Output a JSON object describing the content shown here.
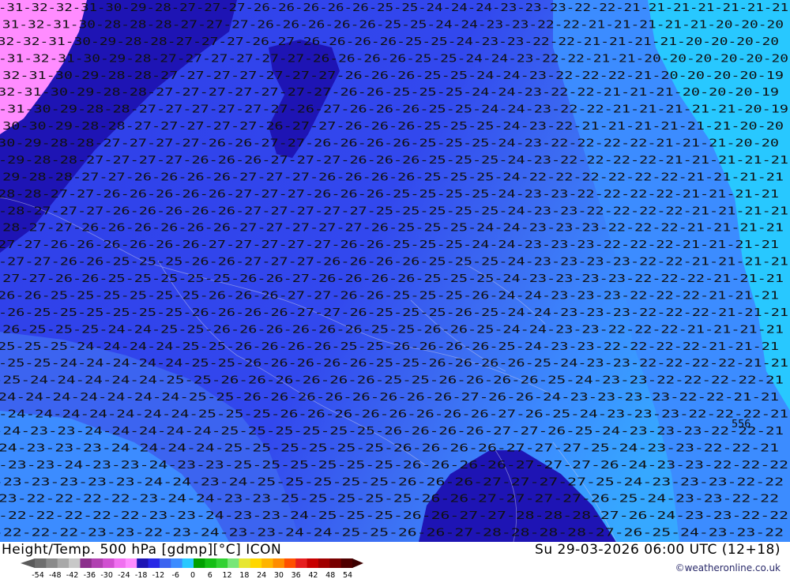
{
  "title": "Height/Temp. 500 hPa [gdmp][°C] ICON",
  "valid_time": "Su 29-03-2026 06:00 UTC (12+18)",
  "credit": "©weatheronline.co.uk",
  "scale": {
    "ticks": [
      "-54",
      "-48",
      "-42",
      "-36",
      "-30",
      "-24",
      "-18",
      "-12",
      "-6",
      "0",
      "6",
      "12",
      "18",
      "24",
      "30",
      "36",
      "42",
      "48",
      "54"
    ],
    "colors": [
      "#6e6e6e",
      "#8a8a8a",
      "#a8a8a8",
      "#c8c8c8",
      "#8c2f8c",
      "#b040b0",
      "#d050d0",
      "#f070f0",
      "#ff8cff",
      "#1e14b4",
      "#2828e6",
      "#3c64f0",
      "#3c8cff",
      "#28c8ff",
      "#00a000",
      "#14be14",
      "#32d232",
      "#78e678",
      "#e6e632",
      "#ffd700",
      "#ffb400",
      "#ff8c00",
      "#ff5000",
      "#e61e1e",
      "#c80000",
      "#a00000",
      "#780000",
      "#500000"
    ]
  },
  "map": {
    "contour_label": "556",
    "temperature_rows": [
      "-31-32-32-31-30-29-28-27-27-27-26-26-26-26-26-25-25-24-24-24-23-23-23-22-22-21-21-21-21-21-21-21",
      "-31-32-31-30-28-28-28-27-27-27-26-26-26-26-26-25-25-24-24-23-23-22-22-21-21-21-21-21-20-20-20",
      "-32-32-31-30-29-28-28-27-27-27-26-27-26-26-26-26-25-25-24-23-23-22-22-21-21-21-21-20-20-20-20",
      "-31-32-31-30-29-28-27-27-27-27-27-27-26-26-26-26-25-25-24-24-23-22-22-21-21-20-20-20-20-20-20",
      "-32-31-30-29-28-28-27-27-27-27-27-27-27-26-26-26-25-25-24-24-23-22-22-22-21-20-20-20-20-19",
      "-32-31-30-29-28-28-27-27-27-27-27-27-27-26-26-25-25-25-24-24-23-22-22-21-21-21-20-20-20-19",
      "-31-30-29-28-28-27-27-27-27-27-27-26-27-26-26-26-25-25-24-24-23-22-22-21-21-21-21-21-20-19",
      "-30-30-29-28-28-27-27-27-27-27-26-27-27-26-26-26-25-25-25-24-23-22-21-21-21-21-21-21-20-20",
      "-30-29-28-28-27-27-27-27-26-26-27-27-26-26-26-26-25-25-25-24-23-22-22-22-22-21-21-21-20-20",
      "-29-28-28-27-27-27-27-26-26-26-27-27-27-26-26-26-25-25-25-24-23-22-22-22-22-21-21-21-21-21",
      "-29-28-28-27-27-26-26-26-26-27-27-27-26-26-26-26-25-25-25-24-22-22-22-22-22-22-21-21-21-21",
      "-28-28-27-27-26-26-26-26-26-27-27-27-26-26-26-25-25-25-25-24-23-23-22-22-22-22-21-21-21-21",
      "-28-27-27-27-26-26-26-26-26-27-27-27-27-27-25-25-25-25-25-24-23-23-22-22-22-22-21-21-21-21",
      "-28-27-27-26-26-26-26-26-26-27-27-27-27-27-26-25-25-25-24-24-23-23-23-22-22-22-21-21-21-21",
      "-27-27-26-26-26-26-26-26-27-27-27-27-27-26-26-25-25-25-24-24-23-23-23-22-22-22-21-21-21-21",
      "-27-27-26-26-25-25-25-26-26-27-27-27-26-26-26-26-25-25-25-24-23-23-23-23-22-22-21-21-21-21",
      "-27-27-26-26-25-25-25-25-25-26-26-27-26-26-26-26-25-25-25-24-23-23-23-23-22-22-22-21-21-21",
      "-26-26-25-25-25-25-25-25-26-26-26-27-27-26-26-25-25-25-26-24-24-23-23-23-22-22-22-21-21-21",
      "-26-25-25-25-25-25-25-26-26-26-26-27-27-26-25-25-25-26-25-24-24-23-23-23-22-22-22-21-21-21",
      "-26-25-25-25-24-24-25-25-26-26-26-26-26-26-25-25-26-26-25-24-24-23-23-22-22-22-21-21-21-21",
      "-25-25-25-24-24-24-24-25-25-26-26-26-26-25-25-26-26-26-26-25-24-23-23-22-22-22-22-21-21-21",
      "-25-25-24-24-24-24-24-25-25-26-26-26-26-26-25-25-26-26-26-26-25-24-23-23-22-22-22-22-21-21",
      "-25-24-24-24-24-24-25-25-26-26-26-26-26-26-25-25-26-26-26-26-25-24-23-23-22-22-22-22-21",
      "-24-24-24-24-24-24-24-25-25-26-26-26-26-26-26-26-26-27-26-26-24-23-23-23-23-22-22-21-21",
      "-24-24-24-24-24-24-24-25-25-25-26-26-26-26-26-26-26-26-27-26-25-24-23-23-23-22-22-22-21",
      "-24-23-23-24-24-24-24-24-25-25-25-25-25-25-26-26-26-26-27-27-26-25-24-23-23-23-22-22-21",
      "-24-23-23-23-24-24-24-24-25-25-25-25-25-25-26-26-26-26-27-27-27-25-24-23-23-22-22-21",
      "-23-23-24-23-23-24-23-23-25-25-25-25-25-25-26-26-26-26-27-27-27-26-24-23-23-22-22-22",
      "-23-23-23-23-23-24-24-23-24-25-25-25-25-25-26-26-26-27-27-27-27-25-24-23-23-23-22-22",
      "-23-22-22-22-22-23-24-24-23-23-25-25-25-25-25-26-26-27-27-27-27-26-25-24-23-23-22-22",
      "-22-22-22-22-22-23-23-24-23-23-24-25-25-25-26-26-27-27-28-28-28-27-26-24-23-23-22-22",
      "-22-22-22-23-23-22-23-24-23-23-24-24-25-25-26-26-27-28-28-28-28-27-26-25-24-23-23-22"
    ]
  }
}
